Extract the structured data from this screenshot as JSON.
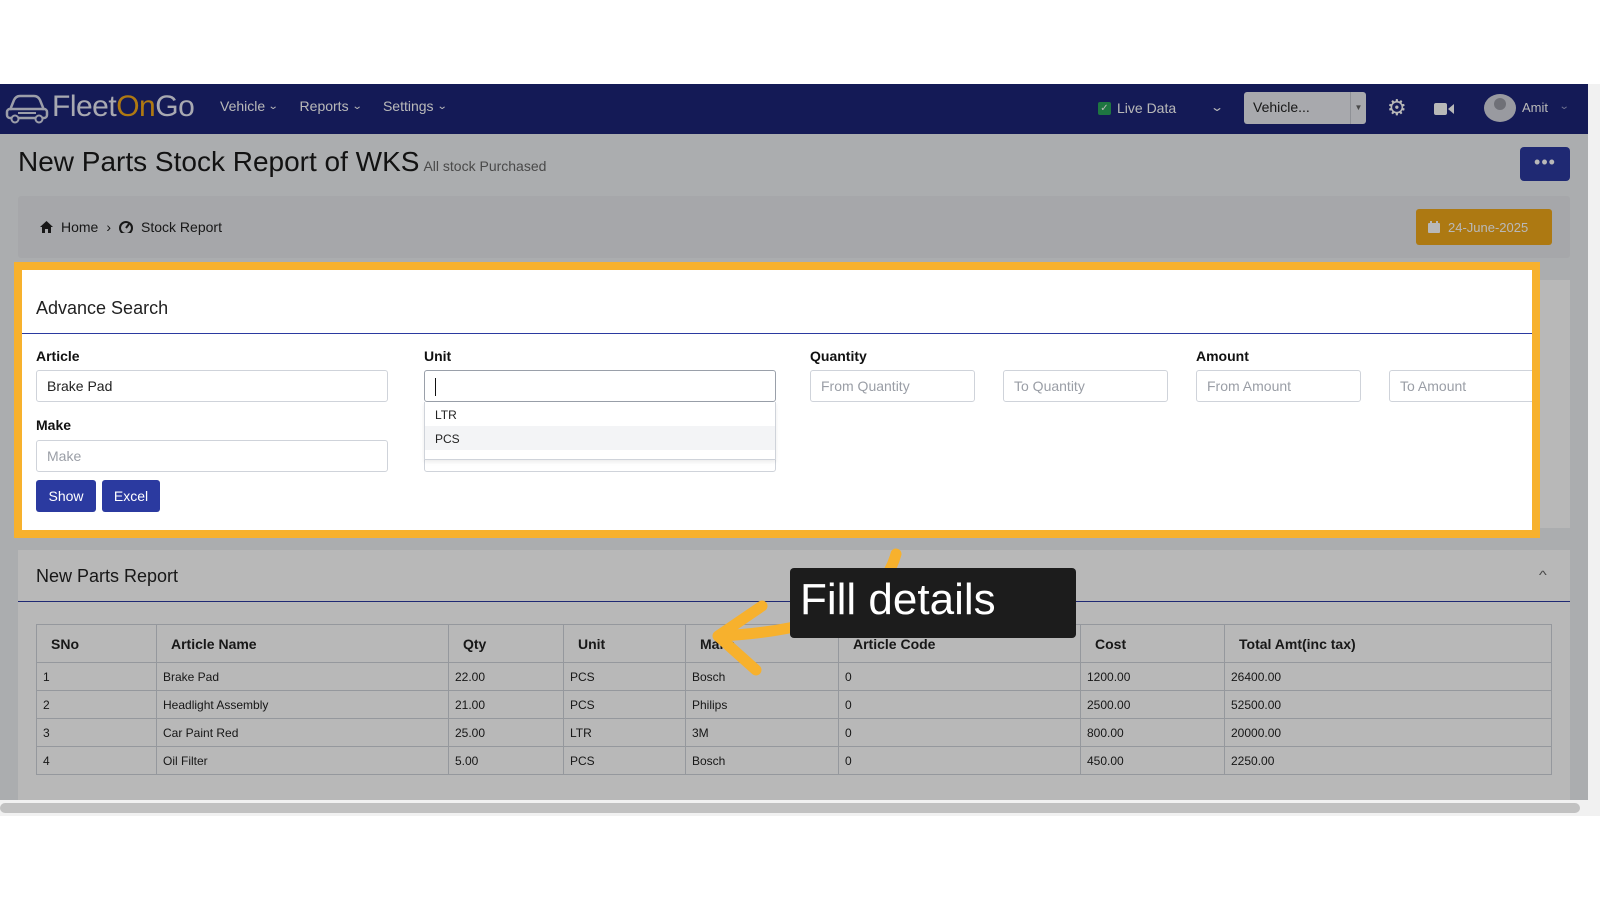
{
  "navbar": {
    "logo_fleet": "Fleet",
    "logo_on": "On",
    "logo_go": "Go",
    "menu": [
      {
        "label": "Vehicle"
      },
      {
        "label": "Reports"
      },
      {
        "label": "Settings"
      }
    ],
    "live_data": "Live Data",
    "vehicle_select": "Vehicle...",
    "user_name": "Amit"
  },
  "header": {
    "title": "New Parts Stock Report of WKS",
    "subtitle": "All stock Purchased",
    "more_label": "•••"
  },
  "breadcrumb": {
    "home": "Home",
    "separator": "›",
    "current": "Stock Report",
    "date": "24-June-2025"
  },
  "search": {
    "title": "Advance Search",
    "article_label": "Article",
    "article_value": "Brake Pad",
    "unit_label": "Unit",
    "unit_value": "",
    "unit_options": [
      "LTR",
      "PCS"
    ],
    "quantity_label": "Quantity",
    "from_quantity_placeholder": "From Quantity",
    "to_quantity_placeholder": "To Quantity",
    "amount_label": "Amount",
    "from_amount_placeholder": "From Amount",
    "to_amount_placeholder": "To Amount",
    "make_label": "Make",
    "make_placeholder": "Make",
    "show_label": "Show",
    "excel_label": "Excel"
  },
  "report": {
    "title": "New Parts Report",
    "columns": [
      "SNo",
      "Article Name",
      "Qty",
      "Unit",
      "Make",
      "Article Code",
      "Cost",
      "Total Amt(inc tax)"
    ],
    "rows": [
      [
        "1",
        "Brake Pad",
        "22.00",
        "PCS",
        "Bosch",
        "0",
        "1200.00",
        "26400.00"
      ],
      [
        "2",
        "Headlight Assembly",
        "21.00",
        "PCS",
        "Philips",
        "0",
        "2500.00",
        "52500.00"
      ],
      [
        "3",
        "Car Paint Red",
        "25.00",
        "LTR",
        "3M",
        "0",
        "800.00",
        "20000.00"
      ],
      [
        "4",
        "Oil Filter",
        "5.00",
        "PCS",
        "Bosch",
        "0",
        "450.00",
        "2250.00"
      ]
    ]
  },
  "callout": {
    "text": "Fill details"
  },
  "colors": {
    "navbar": "#1c2478",
    "primary_button": "#2b3aa0",
    "accent_orange": "#f7b12d",
    "date_button": "#f0a81a"
  }
}
